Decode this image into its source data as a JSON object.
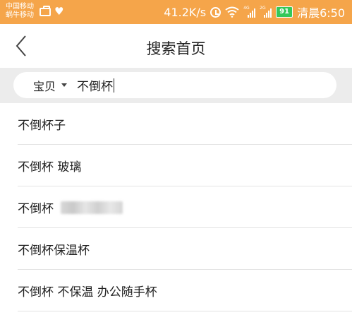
{
  "status_bar": {
    "carrier_1": "中国移动",
    "carrier_2": "蜗牛移动",
    "net_speed": "41.2K/s",
    "battery": "91",
    "time": "清晨6:50",
    "bg_color": "#f5a54a",
    "icons": [
      "briefcase-icon",
      "heart-icon",
      "alarm-icon",
      "wifi-icon",
      "signal-icon",
      "battery-icon"
    ]
  },
  "header": {
    "title": "搜索首页",
    "back_icon": "chevron-left-icon"
  },
  "search": {
    "scope": "宝贝",
    "query": "不倒杯"
  },
  "suggestions": [
    {
      "text": "不倒杯子"
    },
    {
      "text": "不倒杯 玻璃"
    },
    {
      "text": "不倒杯",
      "blurred": true
    },
    {
      "text": "不倒杯保温杯"
    },
    {
      "text": "不倒杯 不保温 办公随手杯"
    }
  ]
}
